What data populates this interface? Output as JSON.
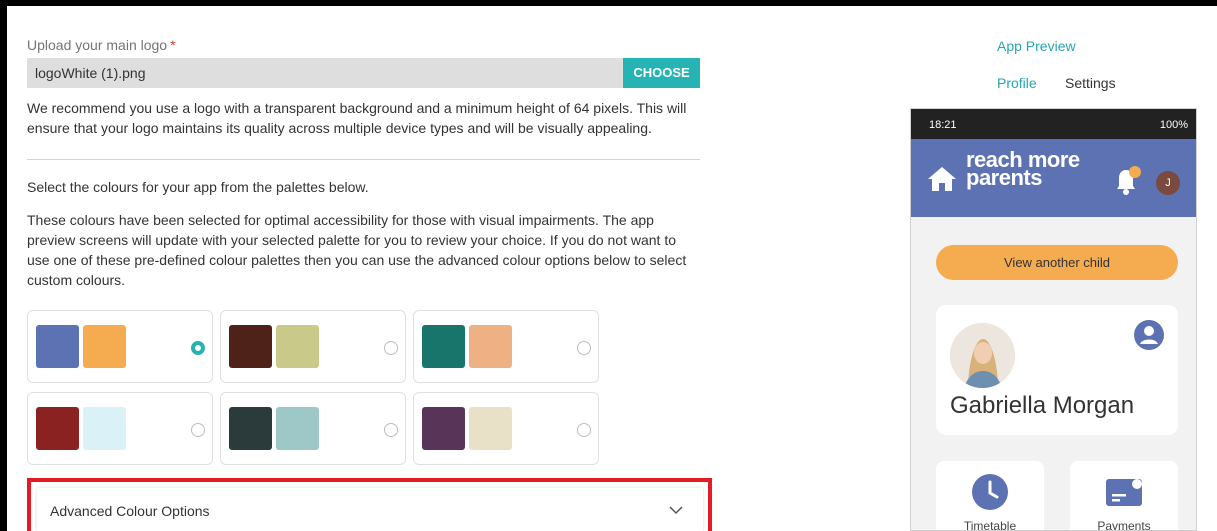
{
  "form": {
    "upload_label": "Upload your main logo",
    "required_mark": "*",
    "file_name": "logoWhite (1).png",
    "choose_label": "CHOOSE",
    "recommend_text": "We recommend you use a logo with a transparent background and a minimum height of 64 pixels. This will ensure that your logo maintains its quality across multiple device types and will be visually appealing.",
    "select_text": "Select the colours for your app from the palettes below.",
    "accessibility_text": "These colours have been selected for optimal accessibility for those with visual impairments. The app preview screens will update with your selected palette for you to review your choice. If you do not want to use one of these pre-defined colour palettes then you can use the advanced colour options below to select custom colours.",
    "advanced_label": "Advanced Colour Options"
  },
  "palettes": [
    {
      "primary": "#5c72b3",
      "secondary": "#f5ab4f",
      "selected": true
    },
    {
      "primary": "#4e2219",
      "secondary": "#c9c98a",
      "selected": false
    },
    {
      "primary": "#17756b",
      "secondary": "#edb184",
      "selected": false
    },
    {
      "primary": "#8b2222",
      "secondary": "#daf2f7",
      "selected": false
    },
    {
      "primary": "#2b3a3a",
      "secondary": "#9ec8c8",
      "selected": false
    },
    {
      "primary": "#583459",
      "secondary": "#e9e0c8",
      "selected": false
    }
  ],
  "preview": {
    "title": "App Preview",
    "tabs": {
      "profile": "Profile",
      "settings": "Settings"
    },
    "status_time": "18:21",
    "status_right": "100%",
    "logo_line1": "reach more",
    "logo_line2": "parents",
    "avatar_initial": "J",
    "view_another_child": "View another child",
    "child_name": "Gabriella Morgan",
    "tiles": {
      "timetable": "Timetable",
      "payments": "Payments"
    }
  },
  "colors": {
    "accent": "#26b3b3",
    "highlight_border": "#e21b24",
    "app_primary": "#5c72b3",
    "app_secondary": "#f5ab4f"
  }
}
